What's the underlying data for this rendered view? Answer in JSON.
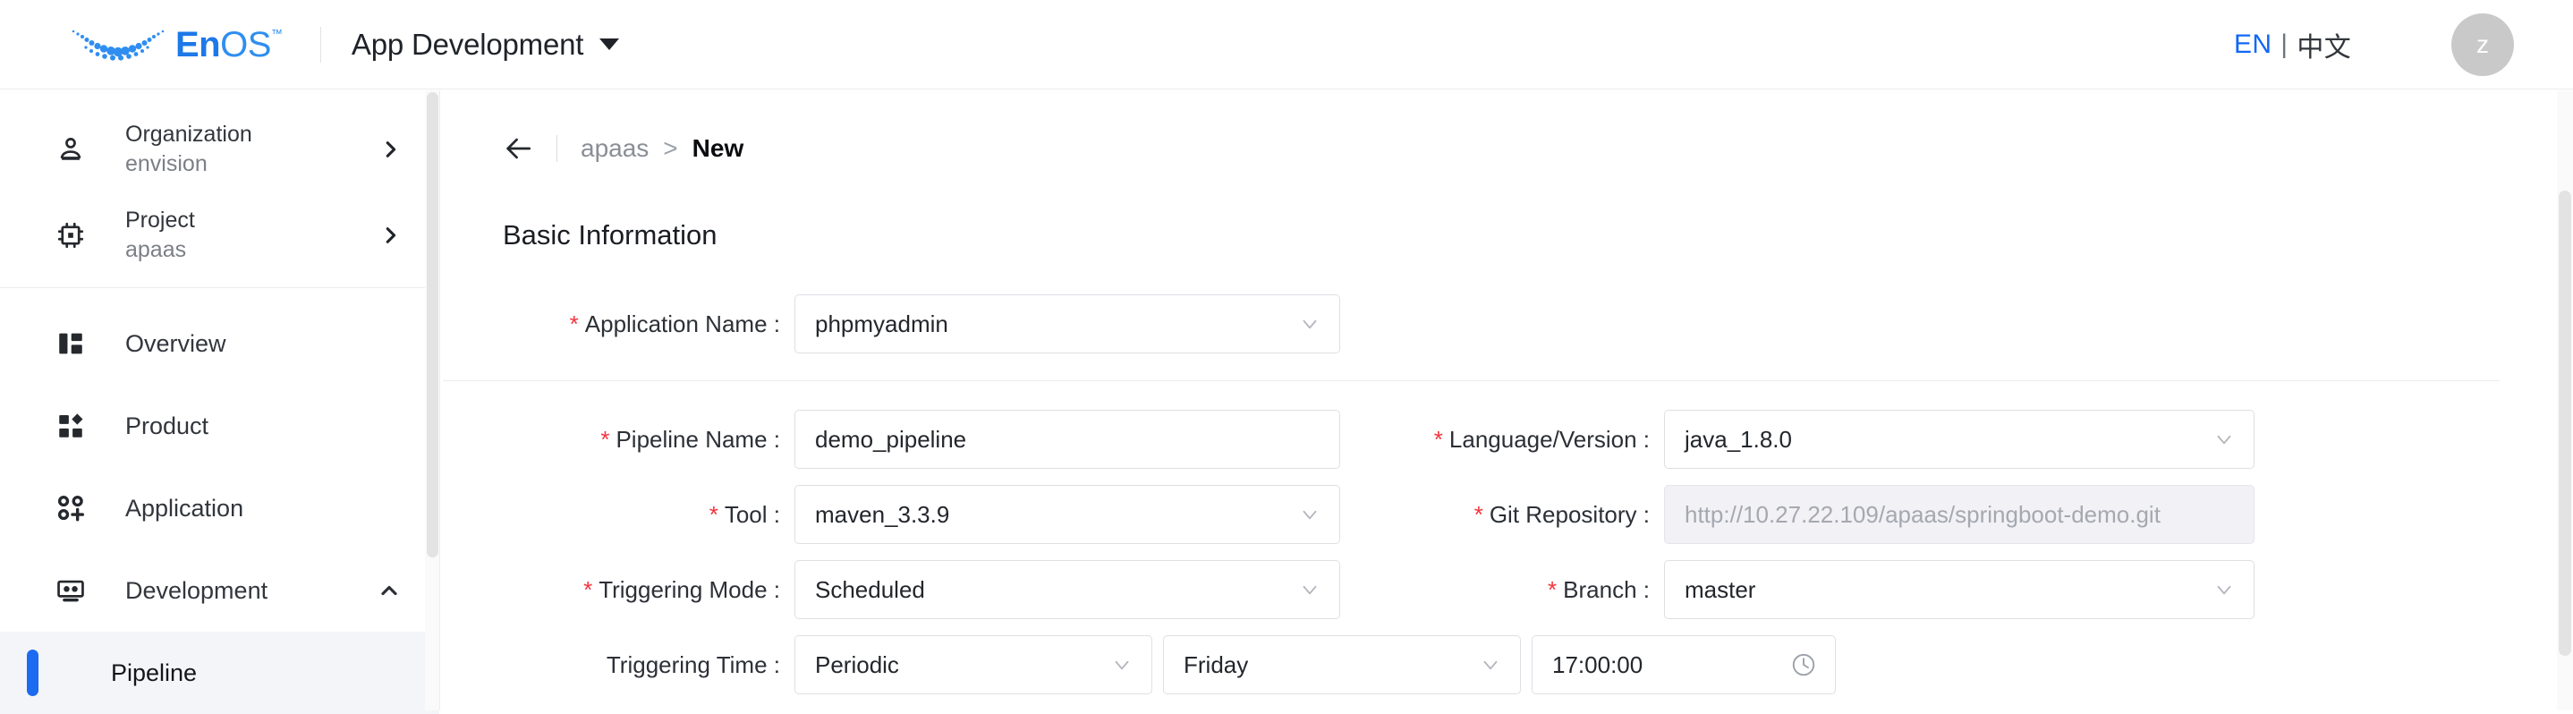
{
  "header": {
    "brand": {
      "en": "En",
      "os": "OS",
      "tm": "™",
      "icon": "enos-logo-icon"
    },
    "app_title": "App Development",
    "caret": "chevron-down-icon",
    "language": {
      "en": "EN",
      "separator": "|",
      "zh": "中文"
    },
    "avatar_initial": "z"
  },
  "sidebar": {
    "context": [
      {
        "label": "Organization",
        "value": "envision",
        "icon": "organization-icon",
        "arrow": "chevron-right-icon"
      },
      {
        "label": "Project",
        "value": "apaas",
        "icon": "project-chip-icon",
        "arrow": "chevron-right-icon"
      }
    ],
    "nav": [
      {
        "label": "Overview",
        "icon": "overview-icon",
        "expandable": false
      },
      {
        "label": "Product",
        "icon": "product-icon",
        "expandable": false
      },
      {
        "label": "Application",
        "icon": "application-icon",
        "expandable": false
      },
      {
        "label": "Development",
        "icon": "development-icon",
        "expandable": true,
        "chevron": "chevron-up-icon"
      }
    ],
    "sub_items": [
      {
        "label": "Pipeline",
        "selected": true
      }
    ]
  },
  "main": {
    "breadcrumb": {
      "back_icon": "arrow-left-icon",
      "parent": "apaas",
      "separator": ">",
      "current": "New"
    },
    "section_title": "Basic Information",
    "fields": {
      "application_name": {
        "label": "Application Name :",
        "required": true,
        "value": "phpmyadmin",
        "type": "select"
      },
      "pipeline_name": {
        "label": "Pipeline Name :",
        "required": true,
        "value": "demo_pipeline",
        "type": "text"
      },
      "language_version": {
        "label": "Language/Version :",
        "required": true,
        "value": "java_1.8.0",
        "type": "select"
      },
      "tool": {
        "label": "Tool :",
        "required": true,
        "value": "maven_3.3.9",
        "type": "select"
      },
      "git_repository": {
        "label": "Git Repository :",
        "required": true,
        "value": "http://10.27.22.109/apaas/springboot-demo.git",
        "type": "text",
        "disabled": true
      },
      "triggering_mode": {
        "label": "Triggering Mode :",
        "required": true,
        "value": "Scheduled",
        "type": "select"
      },
      "branch": {
        "label": "Branch :",
        "required": true,
        "value": "master",
        "type": "select"
      },
      "triggering_time": {
        "label": "Triggering Time :",
        "required": false,
        "frequency": "Periodic",
        "day": "Friday",
        "time": "17:00:00",
        "clock_icon": "clock-icon"
      }
    }
  },
  "colors": {
    "accent_blue": "#1c6bf0",
    "link_blue": "#1268f5",
    "required_red": "#f4333d",
    "selected_bg": "#f4f5f9",
    "border": "#dfdfe4",
    "disabled_bg": "#f1f1f6"
  }
}
